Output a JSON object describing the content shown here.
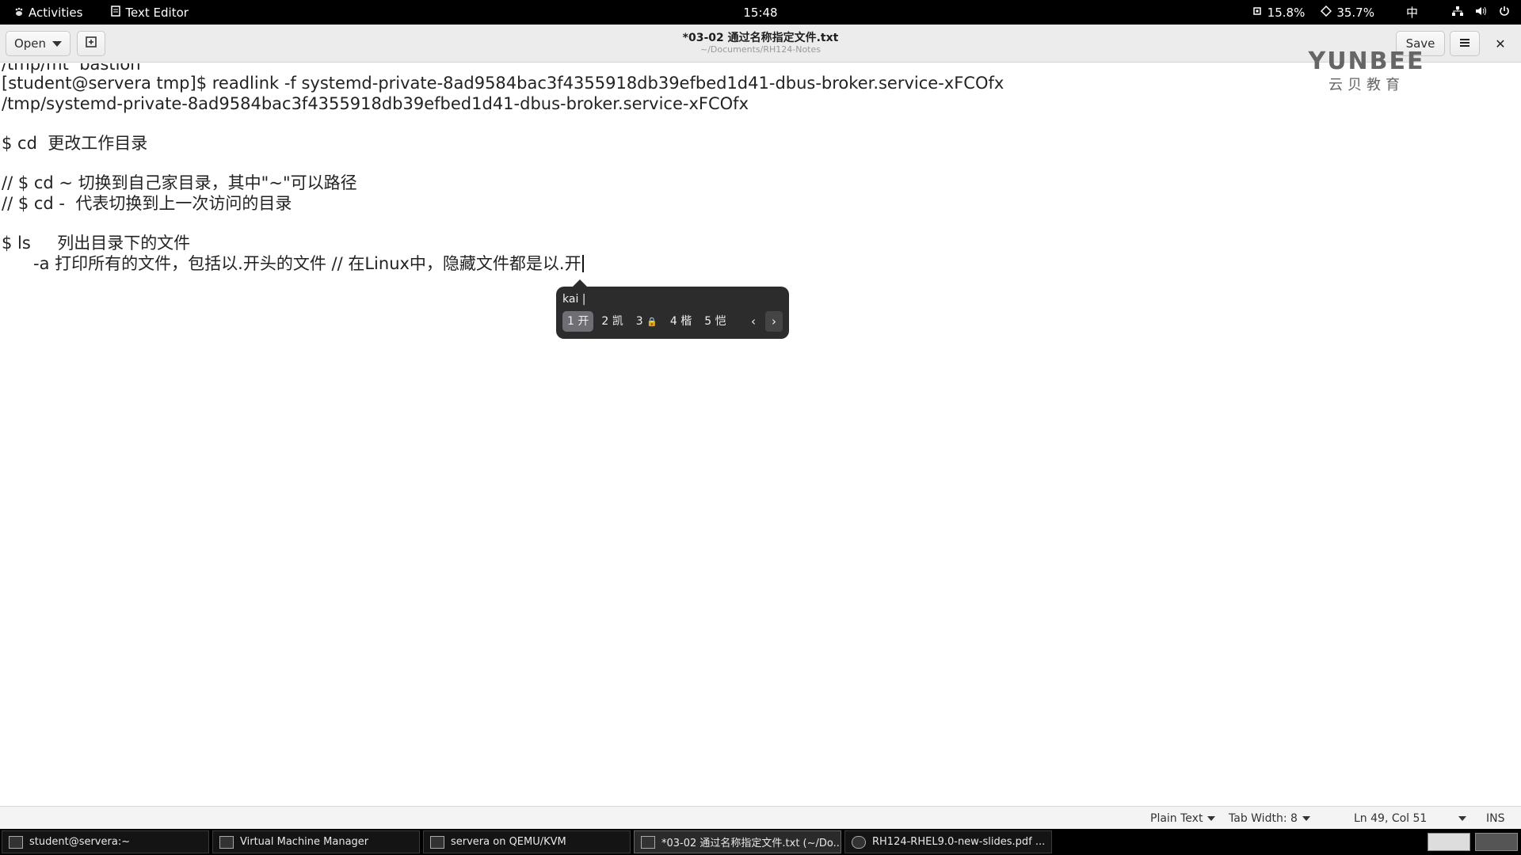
{
  "topbar": {
    "activities": "Activities",
    "app_name": "Text Editor",
    "clock": "15:48",
    "cpu": "15.8%",
    "mem": "35.7%",
    "input_method": "中"
  },
  "header": {
    "open_label": "Open",
    "save_label": "Save",
    "title": "*03-02 通过名称指定文件.txt",
    "subtitle": "~/Documents/RH124-Notes"
  },
  "watermark": {
    "brand": "YUNBEE",
    "sub": "云贝教育"
  },
  "editor": {
    "lines": [
      "/tmp/mt  bastion",
      "[student@servera tmp]$ readlink -f systemd-private-8ad9584bac3f4355918db39efbed1d41-dbus-broker.service-xFCOfx",
      "/tmp/systemd-private-8ad9584bac3f4355918db39efbed1d41-dbus-broker.service-xFCOfx",
      "",
      "$ cd  更改工作目录",
      "",
      "// $ cd ~ 切换到自己家目录，其中\"~\"可以路径",
      "// $ cd -  代表切换到上一次访问的目录",
      "",
      "$ ls     列出目录下的文件",
      "      -a 打印所有的文件，包括以.开头的文件 // 在Linux中，隐藏文件都是以.开"
    ]
  },
  "ime": {
    "preedit": "kai |",
    "candidates": [
      {
        "index": "1",
        "text": "开"
      },
      {
        "index": "2",
        "text": "凯"
      },
      {
        "index": "3",
        "text": "🔒"
      },
      {
        "index": "4",
        "text": "楷"
      },
      {
        "index": "5",
        "text": "恺"
      }
    ],
    "prev": "‹",
    "next": "›"
  },
  "statusbar": {
    "language": "Plain Text",
    "tab_width": "Tab Width: 8",
    "position": "Ln 49, Col 51",
    "mode": "INS"
  },
  "taskbar": {
    "tasks": [
      "student@servera:~",
      "Virtual Machine Manager",
      "servera on QEMU/KVM",
      "*03-02 通过名称指定文件.txt (~/Do...",
      "RH124-RHEL9.0-new-slides.pdf ..."
    ]
  }
}
